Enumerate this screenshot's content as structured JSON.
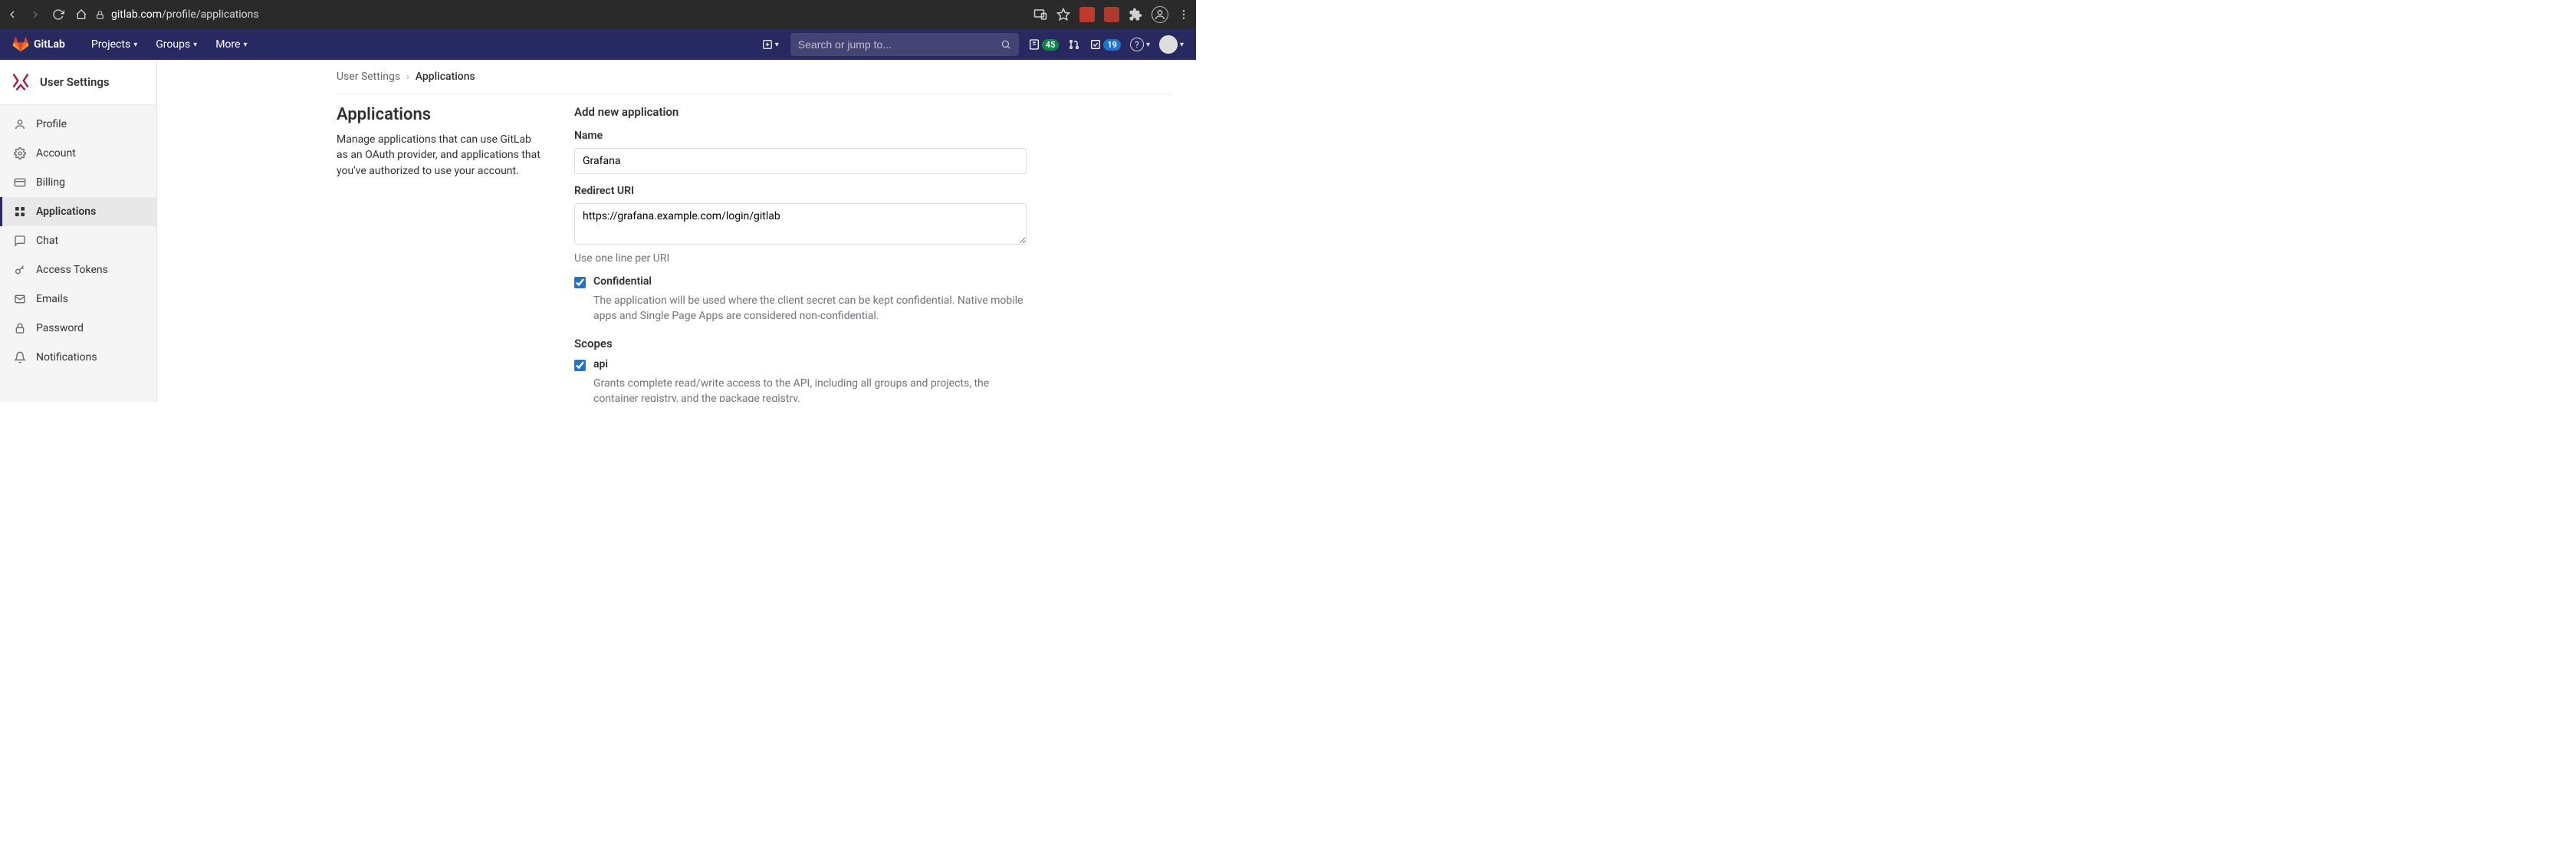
{
  "browser": {
    "url_host": "gitlab.com",
    "url_path": "/profile/applications"
  },
  "topnav": {
    "brand": "GitLab",
    "items": [
      {
        "label": "Projects"
      },
      {
        "label": "Groups"
      },
      {
        "label": "More"
      }
    ],
    "search_placeholder": "Search or jump to...",
    "issues_count": "45",
    "todos_count": "19"
  },
  "sidebar": {
    "header": "User Settings",
    "items": [
      {
        "label": "Profile",
        "icon": "user-icon"
      },
      {
        "label": "Account",
        "icon": "gear-icon"
      },
      {
        "label": "Billing",
        "icon": "credit-card-icon"
      },
      {
        "label": "Applications",
        "icon": "apps-icon",
        "active": true
      },
      {
        "label": "Chat",
        "icon": "chat-icon"
      },
      {
        "label": "Access Tokens",
        "icon": "key-icon"
      },
      {
        "label": "Emails",
        "icon": "mail-icon"
      },
      {
        "label": "Password",
        "icon": "lock-icon"
      },
      {
        "label": "Notifications",
        "icon": "bell-icon"
      }
    ]
  },
  "breadcrumbs": {
    "root": "User Settings",
    "current": "Applications"
  },
  "page": {
    "heading": "Applications",
    "description": "Manage applications that can use GitLab as an OAuth provider, and applications that you've authorized to use your account."
  },
  "form": {
    "title": "Add new application",
    "name_label": "Name",
    "name_value": "Grafana",
    "redirect_label": "Redirect URI",
    "redirect_value": "https://grafana.example.com/login/gitlab",
    "redirect_help": "Use one line per URI",
    "confidential_label": "Confidential",
    "confidential_checked": true,
    "confidential_desc": "The application will be used where the client secret can be kept confidential. Native mobile apps and Single Page Apps are considered non-confidential.",
    "scopes_label": "Scopes",
    "scopes": [
      {
        "name": "api",
        "checked": true,
        "desc": "Grants complete read/write access to the API, including all groups and projects, the container registry, and the package registry."
      }
    ]
  }
}
